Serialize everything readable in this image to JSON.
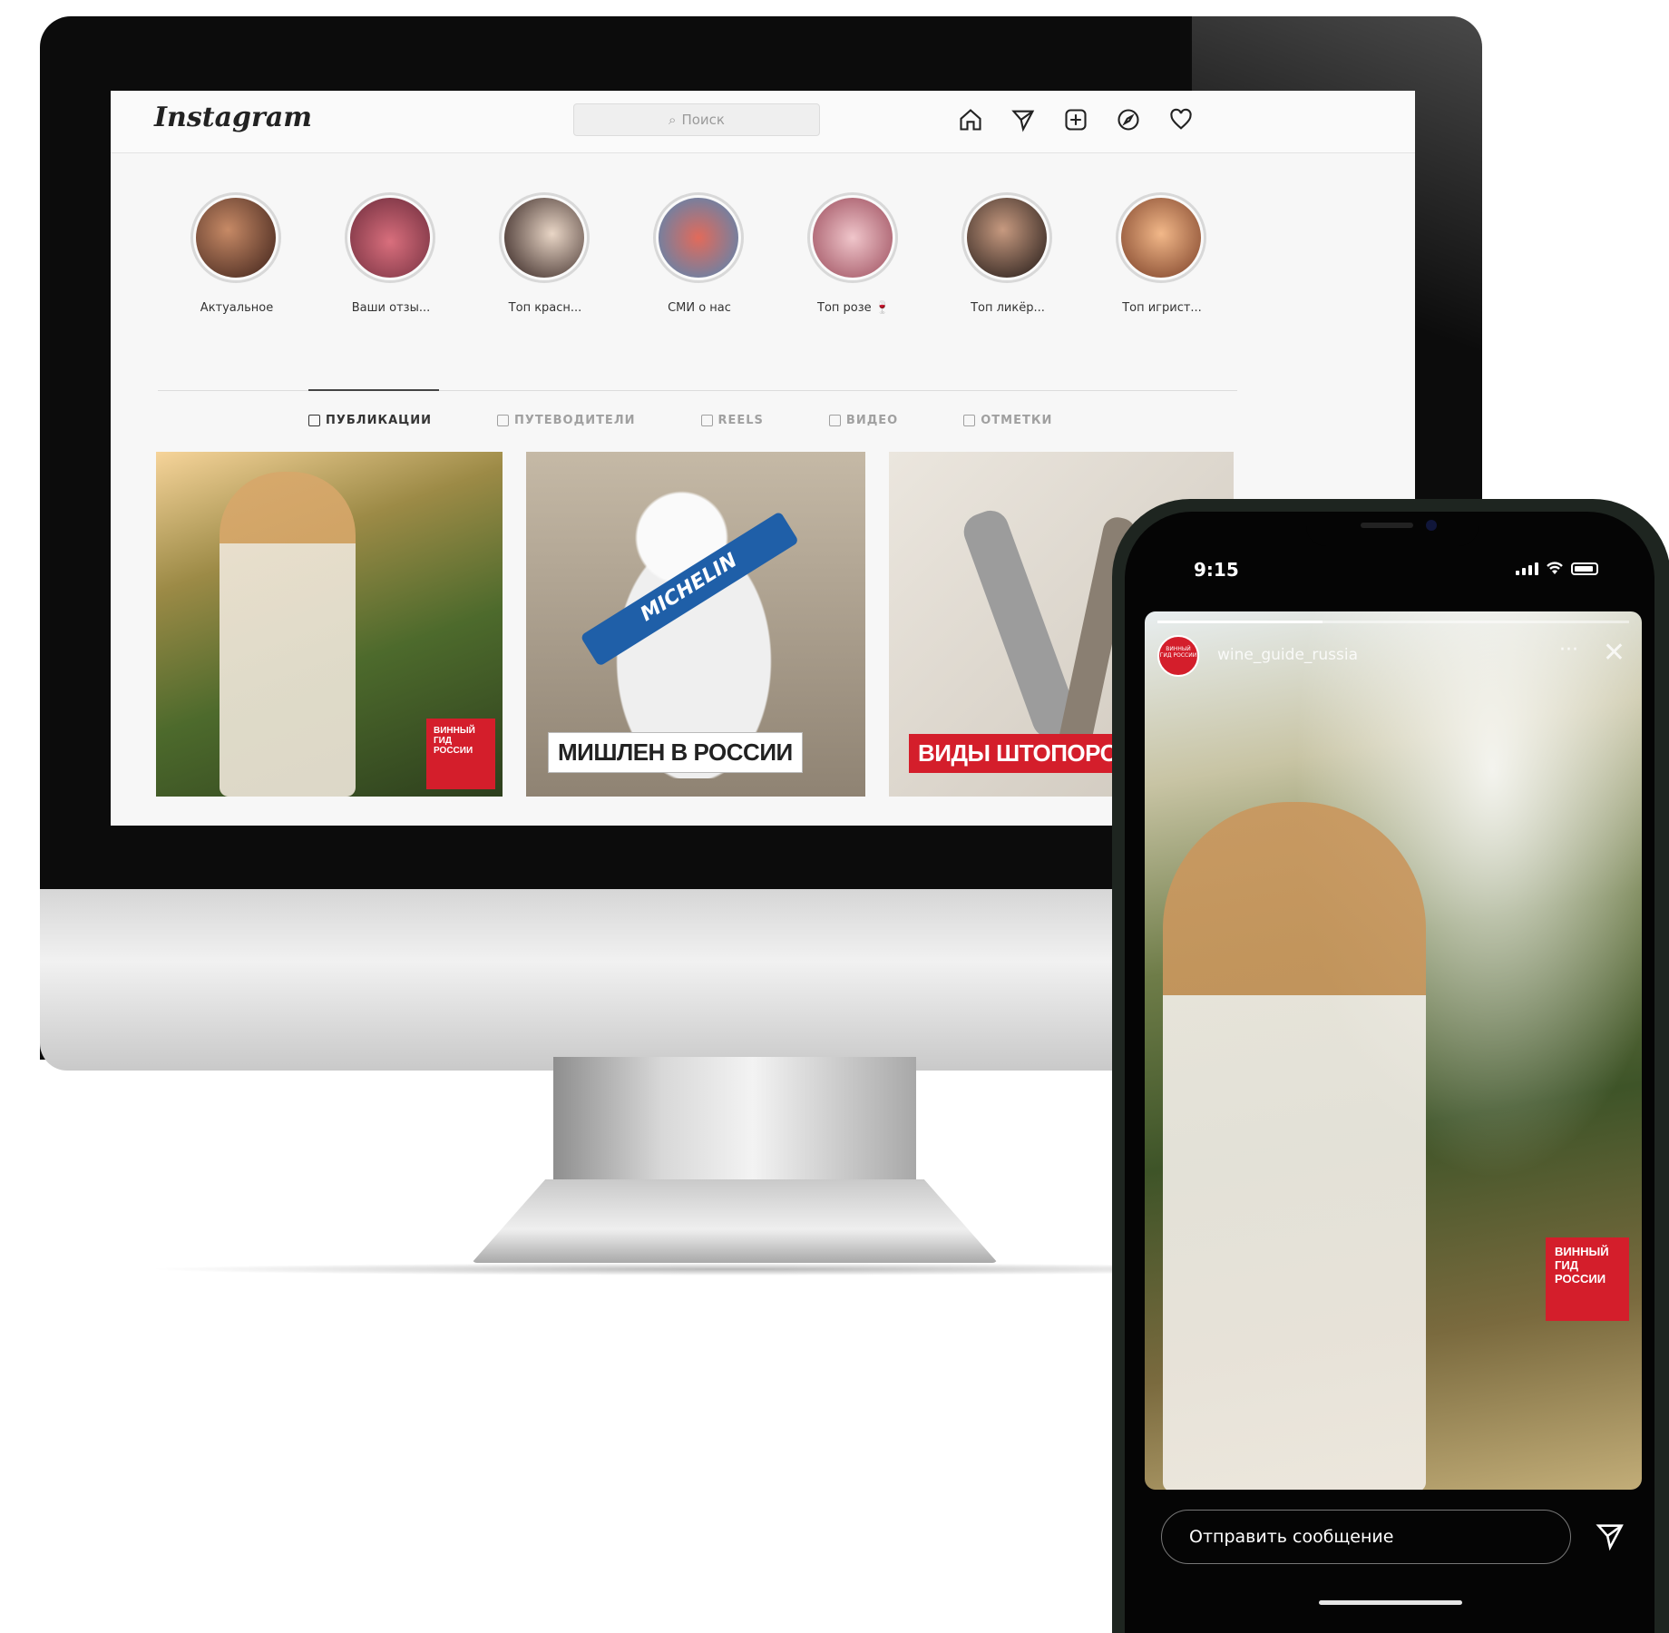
{
  "desktop": {
    "logo": "Instagram",
    "search_placeholder": "Поиск",
    "nav_icons": [
      "home-icon",
      "direct-icon",
      "new-post-icon",
      "explore-icon",
      "activity-icon"
    ],
    "stories": [
      {
        "label": "Актуальное",
        "color": "#6b3a2a"
      },
      {
        "label": "Ваши отзы...",
        "color": "#a13b4b"
      },
      {
        "label": "Топ красн...",
        "color": "#3a2422"
      },
      {
        "label": "СМИ о нас",
        "color": "#6ea2c9"
      },
      {
        "label": "Топ розе 🍷",
        "color": "#b25c6a"
      },
      {
        "label": "Топ ликёр...",
        "color": "#2d211d"
      },
      {
        "label": "Топ игрист...",
        "color": "#9a5a3b"
      }
    ],
    "tabs": [
      {
        "label": "ПУБЛИКАЦИИ",
        "active": true
      },
      {
        "label": "ПУТЕВОДИТЕЛИ",
        "active": false
      },
      {
        "label": "REELS",
        "active": false
      },
      {
        "label": "ВИДЕО",
        "active": false
      },
      {
        "label": "ОТМЕТКИ",
        "active": false
      }
    ],
    "posts": [
      {
        "caption": "",
        "badge": "ВИННЫЙ ГИД РОССИИ"
      },
      {
        "caption": "МИШЛЕН В РОССИИ",
        "sash_text": "MICHELIN"
      },
      {
        "caption": "ВИДЫ ШТОПОРОВ"
      }
    ]
  },
  "phone": {
    "status_time": "9:15",
    "story": {
      "avatar_text": "ВИННЫЙ ГИД РОССИИ",
      "username": "wine_guide_russia",
      "progress": 0.35,
      "badge_text": "ВИННЫЙ ГИД РОССИИ"
    },
    "reply_placeholder": "Отправить сообщение"
  },
  "colors": {
    "brand_red": "#d41e2b",
    "michelin_blue": "#1f5fa8"
  }
}
